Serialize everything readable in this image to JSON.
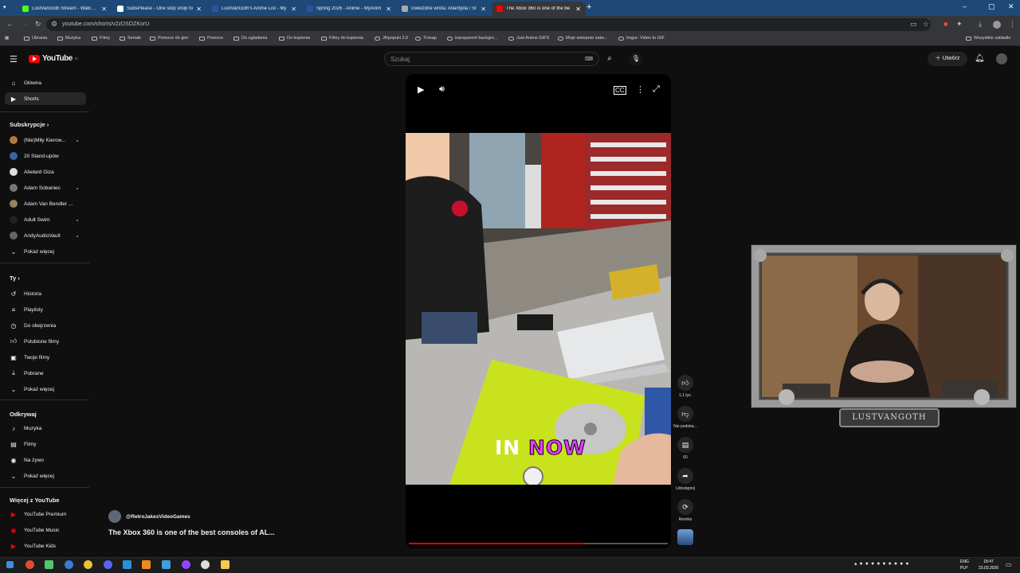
{
  "browser": {
    "tabs": [
      {
        "title": "LustVanGoth Stream - Watch Li",
        "color": "#53fc18"
      },
      {
        "title": "SubsPlease - One stop shop fo",
        "color": "#ffffff"
      },
      {
        "title": "LustVanGoth's Anime List - My",
        "color": "#2e51a2"
      },
      {
        "title": "Spring 2026 - Anime - MyAnim",
        "color": "#2e51a2"
      },
      {
        "title": "Gwiezdne wrota: Atlantyda / St",
        "color": "#aaaaaa"
      },
      {
        "title": "The Xbox 360 is one of the be",
        "color": "#ff0000",
        "active": true
      }
    ],
    "new_tab": "+",
    "url": "youtube.com/shorts/v2zDSOZKorU",
    "bookmarks": [
      "Ubrania",
      "Muzyka",
      "Filmy",
      "Seriale",
      "Pomoce do gier",
      "Pomoce",
      "Do ogladania",
      "Do kupienia",
      "Filmy do kupienia",
      "JRpopuki 2.0",
      "Trzeap",
      "transparent backgro...",
      "Just Anime GIFS",
      "Moje wstepnie zatw...",
      "Imgur: Video to GIF"
    ],
    "bookmarks_right": "Wszystkie zakładki"
  },
  "header": {
    "logo": "YouTube",
    "logo_region": "PL",
    "search_placeholder": "Szukaj",
    "create_label": "Utwórz"
  },
  "sidebar": {
    "main": [
      {
        "label": "Główna",
        "icon": "home-icon"
      },
      {
        "label": "Shorts",
        "icon": "shorts-icon",
        "active": true
      }
    ],
    "subs_header": "Subskrypcje",
    "subs": [
      {
        "label": "(Nie)Miły Kierow...",
        "color": "#b07a3e",
        "dot": true
      },
      {
        "label": "20 Stand-upów",
        "color": "#3c64a0",
        "dot": false
      },
      {
        "label": "Abelard Giza",
        "color": "#dddddd",
        "dot": false
      },
      {
        "label": "Adam Sobaniec",
        "color": "#777777",
        "dot": true
      },
      {
        "label": "Adam Van Bendler ...",
        "color": "#9a8060",
        "dot": false
      },
      {
        "label": "Adult Swim",
        "color": "#222222",
        "dot": true
      },
      {
        "label": "AndyAudioVault",
        "color": "#666666",
        "dot": true
      }
    ],
    "subs_more": "Pokaż więcej",
    "you_header": "Ty",
    "you": [
      {
        "label": "Historia",
        "icon": "history-icon"
      },
      {
        "label": "Playlisty",
        "icon": "playlists-icon"
      },
      {
        "label": "Do obejrzenia",
        "icon": "watch-later-icon"
      },
      {
        "label": "Polubione filmy",
        "icon": "liked-icon"
      },
      {
        "label": "Twoje filmy",
        "icon": "your-videos-icon"
      },
      {
        "label": "Pobrane",
        "icon": "download-icon"
      }
    ],
    "you_more": "Pokaż więcej",
    "explore_header": "Odkrywaj",
    "explore": [
      {
        "label": "Muzyka",
        "icon": "music-icon"
      },
      {
        "label": "Filmy",
        "icon": "movies-icon"
      },
      {
        "label": "Na żywo",
        "icon": "live-icon"
      }
    ],
    "explore_more": "Pokaż więcej",
    "more_header": "Więcej z YouTube",
    "more": [
      {
        "label": "YouTube Premium"
      },
      {
        "label": "YouTube Music"
      },
      {
        "label": "YouTube Kids"
      }
    ]
  },
  "short": {
    "caption_in": "IN",
    "caption_now": "NOW",
    "progress": 0.68,
    "channel": "@RetroJakesVideoGames",
    "title": "The Xbox 360 is one of the best consoles of AL...",
    "likes": "1,1 tys.",
    "dislike_label": "Nie podoba...",
    "comments": "60",
    "share_label": "Udostępnij",
    "remix_label": "Remiks"
  },
  "overlay": {
    "streamer_tag": "LUSTVANGOTH"
  },
  "taskbar": {
    "lang_line1": "ENG",
    "lang_line2": "PLP",
    "time": "18:47",
    "date": "23.03.2026"
  }
}
